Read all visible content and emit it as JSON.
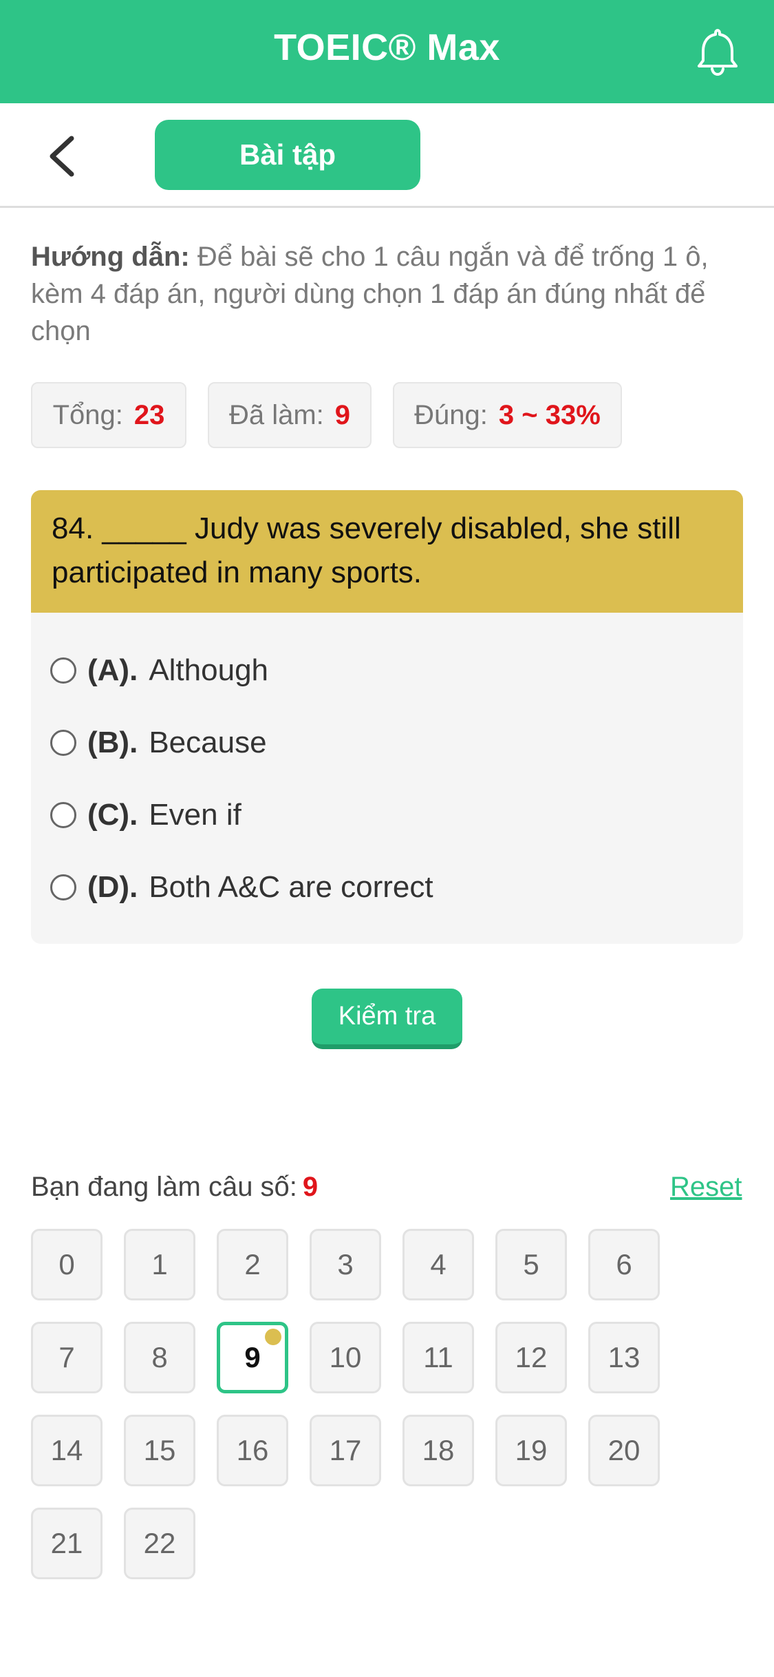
{
  "header": {
    "title": "TOEIC® Max",
    "icon": "bell-icon"
  },
  "subheader": {
    "back_icon": "chevron-left-icon",
    "tab_label": "Bài tập"
  },
  "guide": {
    "label": "Hướng dẫn:",
    "text": " Để bài sẽ cho 1 câu ngắn và để trống 1 ô, kèm 4 đáp án, người dùng chọn 1 đáp án đúng nhất để chọn"
  },
  "stats": {
    "total_label": "Tổng:",
    "total_value": "23",
    "done_label": "Đã làm:",
    "done_value": "9",
    "correct_label": "Đúng:",
    "correct_value": "3 ~ 33%"
  },
  "question": {
    "text": "84. _____ Judy was severely disabled, she still participated in many sports.",
    "options": [
      {
        "label": "(A).",
        "text": "Although"
      },
      {
        "label": "(B).",
        "text": "Because"
      },
      {
        "label": "(C).",
        "text": "Even if"
      },
      {
        "label": "(D).",
        "text": "Both A&C are correct"
      }
    ]
  },
  "check_button": "Kiểm tra",
  "navigator": {
    "current_label": "Bạn đang làm câu số:",
    "current_value": "9",
    "reset_label": "Reset",
    "numbers": [
      "0",
      "1",
      "2",
      "3",
      "4",
      "5",
      "6",
      "7",
      "8",
      "9",
      "10",
      "11",
      "12",
      "13",
      "14",
      "15",
      "16",
      "17",
      "18",
      "19",
      "20",
      "21",
      "22"
    ],
    "active": "9",
    "colors": {
      "accent": "#2ec487",
      "highlight": "#dbbe50",
      "value_red": "#e0151b"
    }
  }
}
